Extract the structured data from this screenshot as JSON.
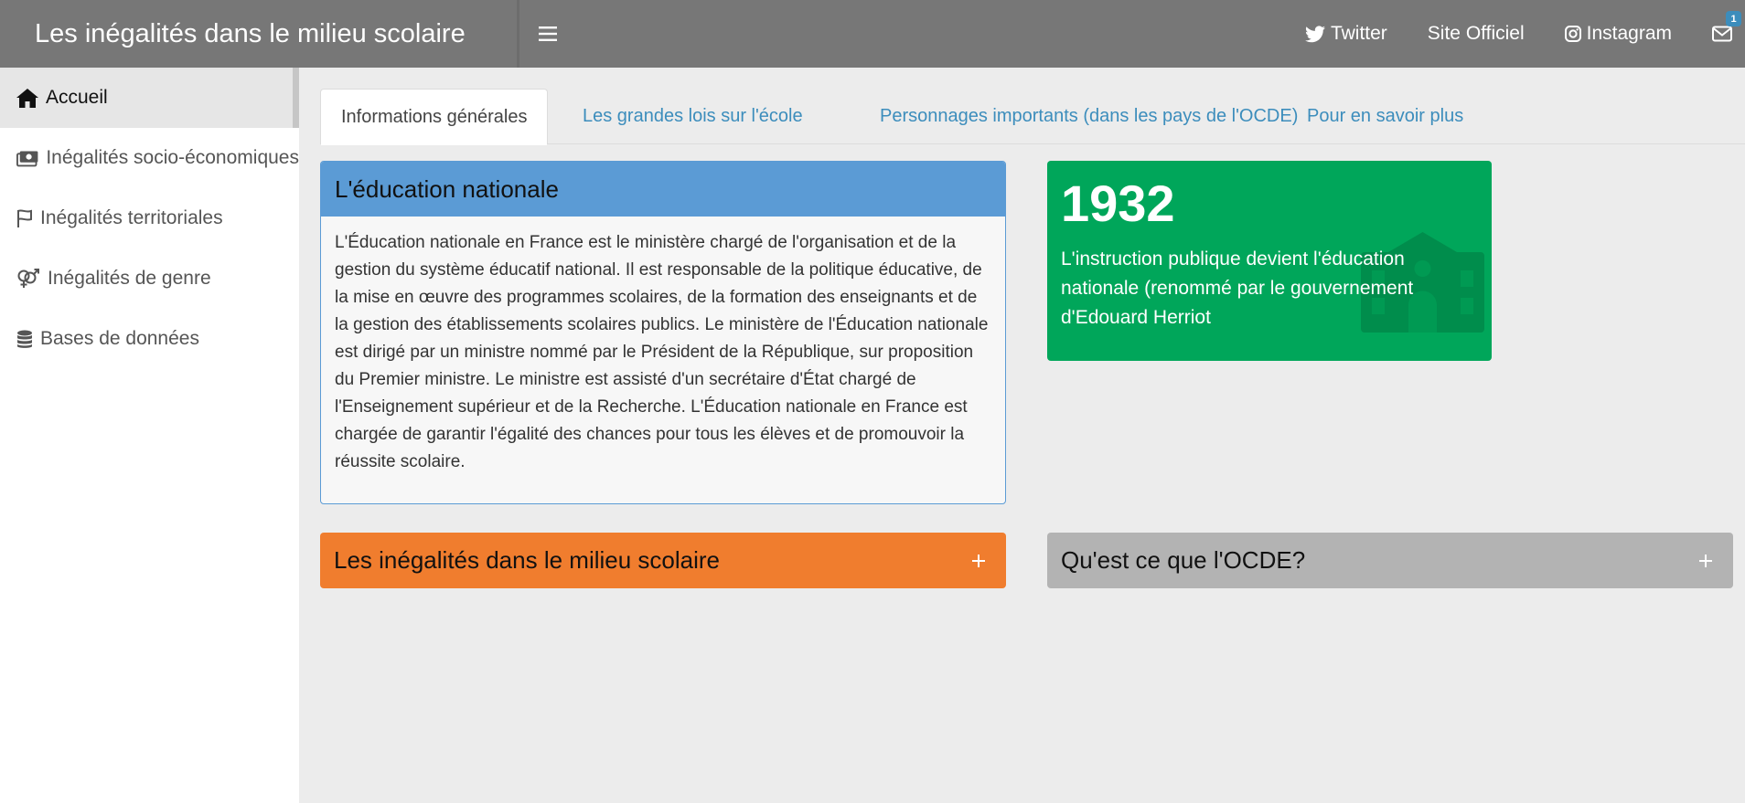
{
  "header": {
    "title": "Les inégalités dans le milieu scolaire",
    "links": {
      "twitter": "Twitter",
      "site": "Site Officiel",
      "instagram": "Instagram"
    },
    "mail_badge": "1"
  },
  "sidebar": {
    "items": [
      {
        "label": "Accueil",
        "icon": "home-icon"
      },
      {
        "label": "Inégalités socio-économiques",
        "icon": "money-icon"
      },
      {
        "label": "Inégalités territoriales",
        "icon": "flag-icon"
      },
      {
        "label": "Inégalités de genre",
        "icon": "venus-mars-icon"
      },
      {
        "label": "Bases de données",
        "icon": "database-icon"
      }
    ]
  },
  "tabs": [
    {
      "label": "Informations générales",
      "active": true
    },
    {
      "label": "Les grandes lois sur l'école"
    },
    {
      "label": "Personnages importants (dans les pays de l'OCDE)"
    },
    {
      "label": "Pour en savoir plus"
    }
  ],
  "edu_box": {
    "title": "L'éducation nationale",
    "body": "L'Éducation nationale en France est le ministère chargé de l'organisation et de la gestion du système éducatif national. Il est responsable de la politique éducative, de la mise en œuvre des programmes scolaires, de la formation des enseignants et de la gestion des établissements scolaires publics. Le ministère de l'Éducation nationale est dirigé par un ministre nommé par le Président de la République, sur proposition du Premier ministre. Le ministre est assisté d'un secrétaire d'État chargé de l'Enseignement supérieur et de la Recherche. L'Éducation nationale en France est chargée de garantir l'égalité des chances pour tous les élèves et de promouvoir la réussite scolaire."
  },
  "value_box": {
    "value": "1932",
    "subtitle": "L'instruction publique devient l'éducation nationale (renommé par le gouvernement d'Edouard Herriot",
    "icon": "school-icon",
    "color": "#00a65a"
  },
  "collapsed_boxes": {
    "inegalites": {
      "title": "Les inégalités dans le milieu scolaire",
      "color": "#f07d2e"
    },
    "ocde": {
      "title": "Qu'est ce que l'OCDE?",
      "color": "#b3b3b3"
    }
  },
  "colors": {
    "header": "#777777",
    "link": "#3c8dbc",
    "primary": "#5b9bd5"
  }
}
